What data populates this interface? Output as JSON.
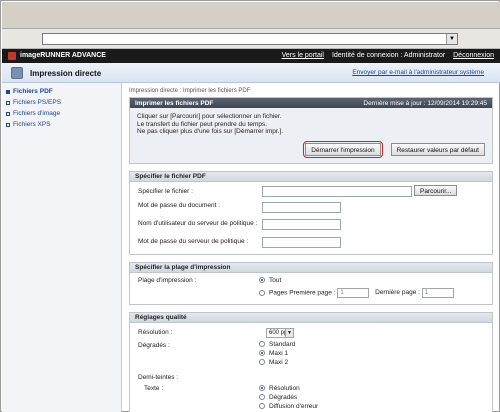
{
  "browser": {
    "address_value": ""
  },
  "header": {
    "brand": "imageRUNNER ADVANCE",
    "portal_link": "Vers le portail",
    "login_info": "Identité de connexion : Administrator",
    "logout": "Déconnexion"
  },
  "subheader": {
    "title": "Impression directe",
    "mail_link": "Envoyer par e-mail à l'administrateur système"
  },
  "sidebar": {
    "items": [
      {
        "label": "Fichiers PDF"
      },
      {
        "label": "Fichiers PS/EPS"
      },
      {
        "label": "Fichiers d'image"
      },
      {
        "label": "Fichiers XPS"
      }
    ]
  },
  "main": {
    "breadcrumb": "Impression directe : Imprimer les fichiers PDF",
    "print_panel": {
      "title": "Imprimer les fichiers PDF",
      "last_update": "Dernière mise à jour : 12/09/2014 19:29:45",
      "info_lines": [
        "Cliquer sur [Parcourir] pour sélectionner un fichier.",
        "Le transfert du fichier peut prendre du temps.",
        "Ne pas cliquer plus d'une fois sur [Démarrer impr.]."
      ],
      "start_button": "Démarrer l'impression",
      "reset_button": "Restaurer valeurs par défaut"
    },
    "file_section": {
      "title": "Spécifier le fichier PDF",
      "file_label": "Spécifier le fichier :",
      "browse_button": "Parcourir...",
      "doc_password_label": "Mot de passe du document :",
      "policy_user_label": "Nom d'utilisateur du serveur de politique :",
      "policy_password_label": "Mot de passe du serveur de politique :"
    },
    "range_section": {
      "title": "Spécifier la plage d'impression",
      "label": "Plage d'impression :",
      "all": "Tout",
      "pages": "Pages",
      "first_page_label": "Première page :",
      "first_page_value": "1",
      "last_page_label": "Dernière page :",
      "last_page_value": "1"
    },
    "quality_section": {
      "title": "Réglages qualité",
      "resolution_label": "Résolution :",
      "resolution_value": "600 ppp",
      "gradation_label": "Dégradés :",
      "gradation_options": [
        "Standard",
        "Maxi 1",
        "Maxi 2"
      ],
      "halftone_label": "Demi-teintes :",
      "text_label": "Texte :",
      "text_options": [
        "Résolution",
        "Dégradés",
        "Diffusion d'erreur"
      ]
    }
  }
}
